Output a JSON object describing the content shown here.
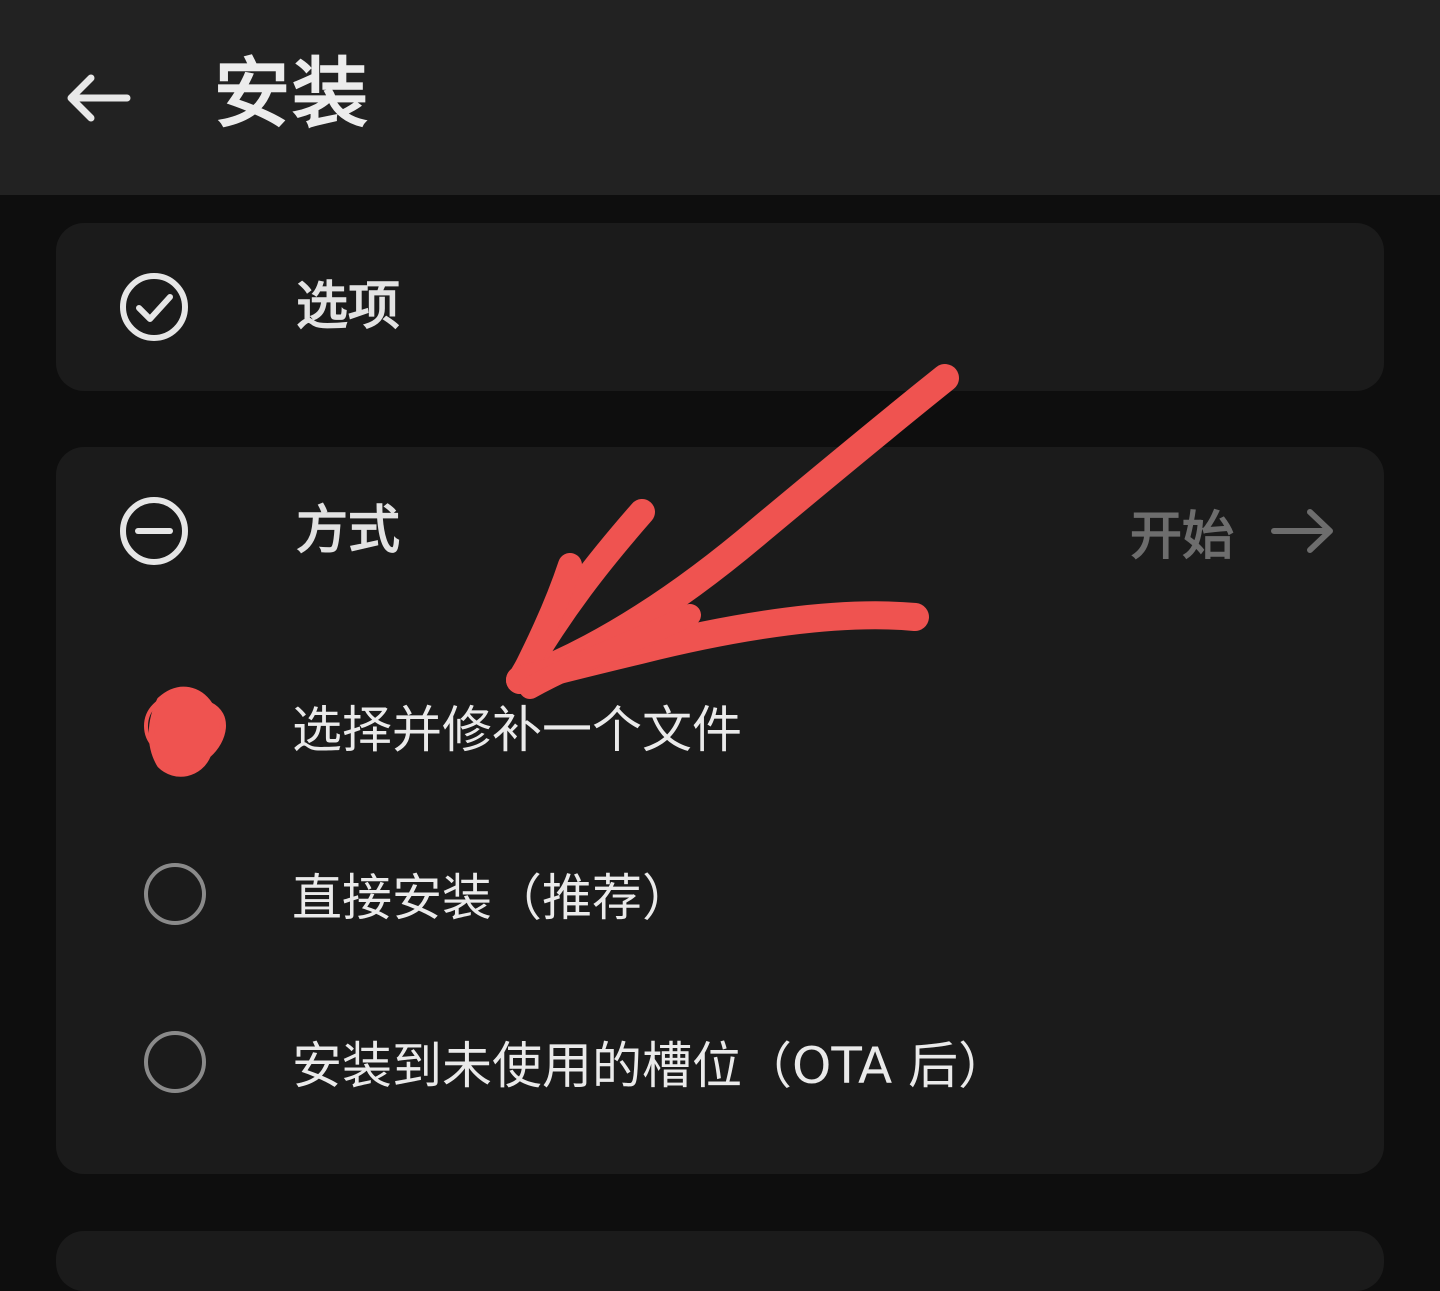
{
  "app_bar": {
    "title": "安装",
    "back_icon": "arrow-left-icon"
  },
  "options_card": {
    "label": "选项",
    "icon": "check-circle-icon"
  },
  "method_card": {
    "label": "方式",
    "icon": "minus-circle-icon",
    "start_label": "开始",
    "start_icon": "arrow-right-icon",
    "options": [
      {
        "label": "选择并修补一个文件",
        "selected": true
      },
      {
        "label": "直接安装（推荐）",
        "selected": false
      },
      {
        "label": "安装到未使用的槽位（OTA 后）",
        "selected": false
      }
    ]
  },
  "colors": {
    "background": "#0e0e0e",
    "app_bar": "#222222",
    "card": "#1b1b1b",
    "annotation": "#ef5350",
    "muted": "#6d6d6d"
  }
}
